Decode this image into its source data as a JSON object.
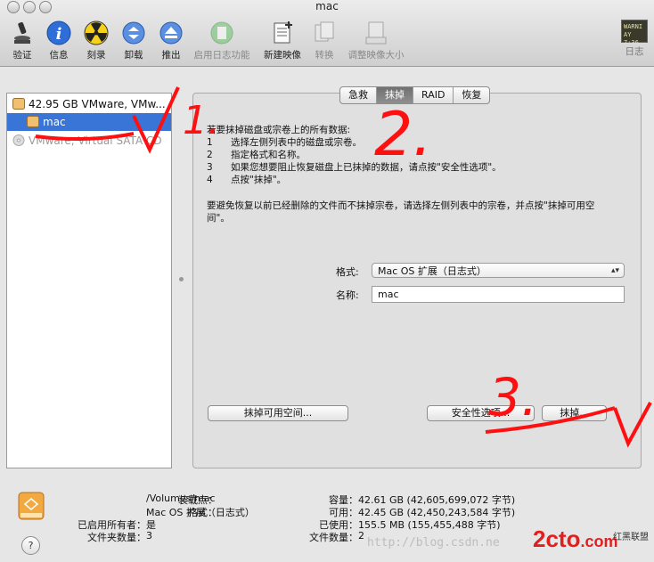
{
  "window": {
    "title": "mac"
  },
  "toolbar": {
    "items": [
      {
        "label": "验证"
      },
      {
        "label": "信息"
      },
      {
        "label": "刻录"
      },
      {
        "label": "卸载"
      },
      {
        "label": "推出"
      },
      {
        "label": "启用日志功能"
      },
      {
        "label": "新建映像"
      },
      {
        "label": "转换"
      },
      {
        "label": "调整映像大小"
      }
    ],
    "log": {
      "label": "日志",
      "badge_line1": "WARNI",
      "badge_line2": "AY 7:36"
    }
  },
  "sidebar": {
    "items": [
      {
        "label": "42.95 GB VMware, VMw..."
      },
      {
        "label": "mac"
      },
      {
        "label": "VMware, Virtual SATA CD"
      }
    ]
  },
  "tabs": [
    "急救",
    "抹掉",
    "RAID",
    "恢复"
  ],
  "erase": {
    "heading": "若要抹掉磁盘或宗卷上的所有数据:",
    "steps": [
      {
        "n": "1",
        "text": "选择左侧列表中的磁盘或宗卷。"
      },
      {
        "n": "2",
        "text": "指定格式和名称。"
      },
      {
        "n": "3",
        "text": "如果您想要阻止恢复磁盘上已抹掉的数据，请点按\"安全性选项\"。"
      },
      {
        "n": "4",
        "text": "点按\"抹掉\"。"
      }
    ],
    "note_line1": "要避免恢复以前已经删除的文件而不抹掉宗卷，请选择左侧列表中的宗卷，并点按\"抹掉可用空",
    "note_line2": "间\"。",
    "format_label": "格式:",
    "format_value": "Mac OS 扩展（日志式）",
    "name_label": "名称:",
    "name_value": "mac",
    "buttons": {
      "erase_free": "抹掉可用空间...",
      "security": "安全性选项...",
      "erase": "抹掉..."
    }
  },
  "info": {
    "left": [
      {
        "label": "装载点：",
        "value": "/Volumes/mac"
      },
      {
        "label": "格式：",
        "value": "Mac OS 扩展（日志式）"
      },
      {
        "label": "已启用所有者：",
        "value": "是"
      },
      {
        "label": "文件夹数量：",
        "value": "3"
      }
    ],
    "right": [
      {
        "label": "容量：",
        "value": "42.61 GB (42,605,699,072 字节)"
      },
      {
        "label": "可用：",
        "value": "42.45 GB (42,450,243,584 字节)"
      },
      {
        "label": "已使用：",
        "value": "155.5 MB (155,455,488 字节)"
      },
      {
        "label": "文件数量：",
        "value": "2"
      }
    ]
  },
  "help": "?",
  "watermark": {
    "url": "http://blog.csdn.ne",
    "brand": "2cto",
    "brand_suffix": ".com",
    "brand_cn": "红黑联盟"
  },
  "annotations": {
    "mark1": "1.",
    "mark2": "2.",
    "mark3": "3."
  },
  "colors": {
    "selection": "#3875d7",
    "annotation_red": "#ff1010"
  }
}
